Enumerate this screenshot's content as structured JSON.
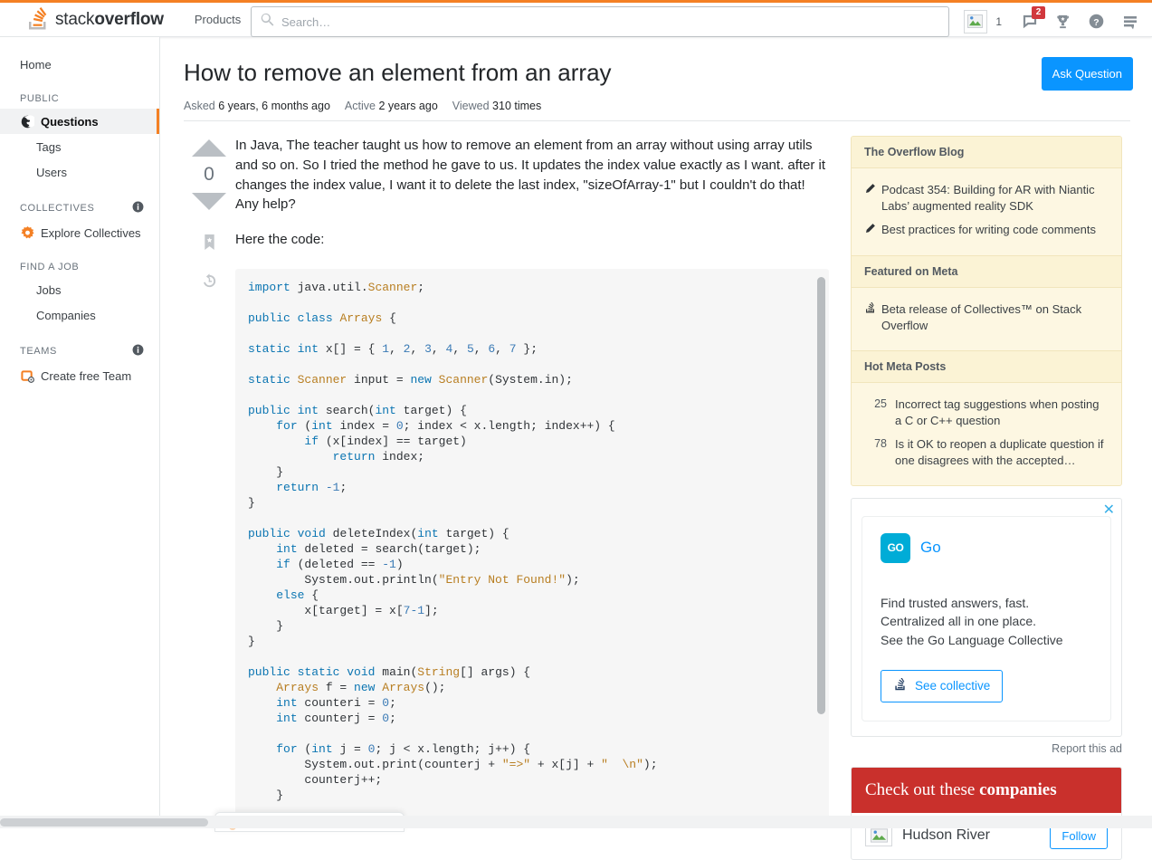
{
  "header": {
    "logo_text_light": "stack",
    "logo_text_bold": "overflow",
    "products_label": "Products",
    "search_placeholder": "Search…",
    "search_value": "",
    "search_icon": "search-icon",
    "reputation": "1",
    "inbox_badge": "2",
    "icons": [
      "avatar-placeholder-icon",
      "inbox-icon",
      "trophy-icon",
      "help-icon",
      "hamburger-icon"
    ]
  },
  "sidebar": {
    "home_label": "Home",
    "sections": [
      {
        "title": "PUBLIC",
        "has_info": false,
        "items": [
          {
            "label": "Questions",
            "icon": "globe-icon",
            "active": true,
            "sub": false
          },
          {
            "label": "Tags",
            "icon": "",
            "active": false,
            "sub": true
          },
          {
            "label": "Users",
            "icon": "",
            "active": false,
            "sub": true
          }
        ]
      },
      {
        "title": "COLLECTIVES",
        "has_info": true,
        "items": [
          {
            "label": "Explore Collectives",
            "icon": "collectives-starburst-icon",
            "active": false,
            "sub": false
          }
        ]
      },
      {
        "title": "FIND A JOB",
        "has_info": false,
        "items": [
          {
            "label": "Jobs",
            "icon": "",
            "active": false,
            "sub": true
          },
          {
            "label": "Companies",
            "icon": "",
            "active": false,
            "sub": true
          }
        ]
      },
      {
        "title": "TEAMS",
        "has_info": true,
        "items": [
          {
            "label": "Create free Team",
            "icon": "teams-icon",
            "active": false,
            "sub": false
          }
        ]
      }
    ]
  },
  "question": {
    "title": "How to remove an element from an array",
    "ask_button": "Ask Question",
    "meta": {
      "asked_label": "Asked",
      "asked_value": "6 years, 6 months ago",
      "active_label": "Active",
      "active_value": "2 years ago",
      "viewed_label": "Viewed",
      "viewed_value": "310 times"
    },
    "vote_score": "0",
    "body_paragraphs": [
      "In Java, The teacher taught us how to remove an element from an array without using array utils and so on. So I tried the method he gave to us. It updates the index value exactly as I want. after it changes the index value, I want it to delete the last index, \"sizeOfArray-1\" but I couldn't do that! Any help?",
      "Here the code:"
    ]
  },
  "code": {
    "language": "java",
    "text": "import java.util.Scanner;\n\npublic class Arrays {\n\nstatic int x[] = { 1, 2, 3, 4, 5, 6, 7 };\n\nstatic Scanner input = new Scanner(System.in);\n\npublic int search(int target) {\n    for (int index = 0; index < x.length; index++) {\n        if (x[index] == target)\n            return index;\n    }\n    return -1;\n}\n\npublic void deleteIndex(int target) {\n    int deleted = search(target);\n    if (deleted == -1)\n        System.out.println(\"Entry Not Found!\");\n    else {\n        x[target] = x[7-1];\n    }\n}\n\npublic static void main(String[] args) {\n    Arrays f = new Arrays();\n    int counteri = 0;\n    int counterj = 0;\n\n    for (int j = 0; j < x.length; j++) {\n        System.out.print(counterj + \"=>\" + x[j] + \"  \\n\");\n        counterj++;\n    }"
  },
  "rail": {
    "blog": {
      "title": "The Overflow Blog",
      "items": [
        {
          "icon": "pencil-icon",
          "text": "Podcast 354: Building for AR with Niantic Labs’ augmented reality SDK"
        },
        {
          "icon": "pencil-icon",
          "text": "Best practices for writing code comments"
        }
      ]
    },
    "meta_featured": {
      "title": "Featured on Meta",
      "items": [
        {
          "icon": "stackoverflow-icon",
          "text": "Beta release of Collectives™ on Stack Overflow"
        }
      ]
    },
    "hot_meta": {
      "title": "Hot Meta Posts",
      "items": [
        {
          "score": "25",
          "text": "Incorrect tag suggestions when posting a C or C++ question"
        },
        {
          "score": "78",
          "text": "Is it OK to reopen a duplicate question if one disagrees with the accepted…"
        }
      ]
    },
    "ad": {
      "close_icon": "close-icon",
      "brand_logo": "GO",
      "brand_name": "Go",
      "copy_lines": [
        "Find trusted answers, fast.",
        "Centralized all in one place.",
        "See the Go Language Collective"
      ],
      "cta_label": "See collective",
      "cta_icon": "stackoverflow-icon",
      "report_label": "Report this ad"
    },
    "companies": {
      "heading_light": "Check out these ",
      "heading_bold": "companies",
      "rows": [
        {
          "name": "Hudson River",
          "button": "Follow"
        }
      ]
    }
  }
}
